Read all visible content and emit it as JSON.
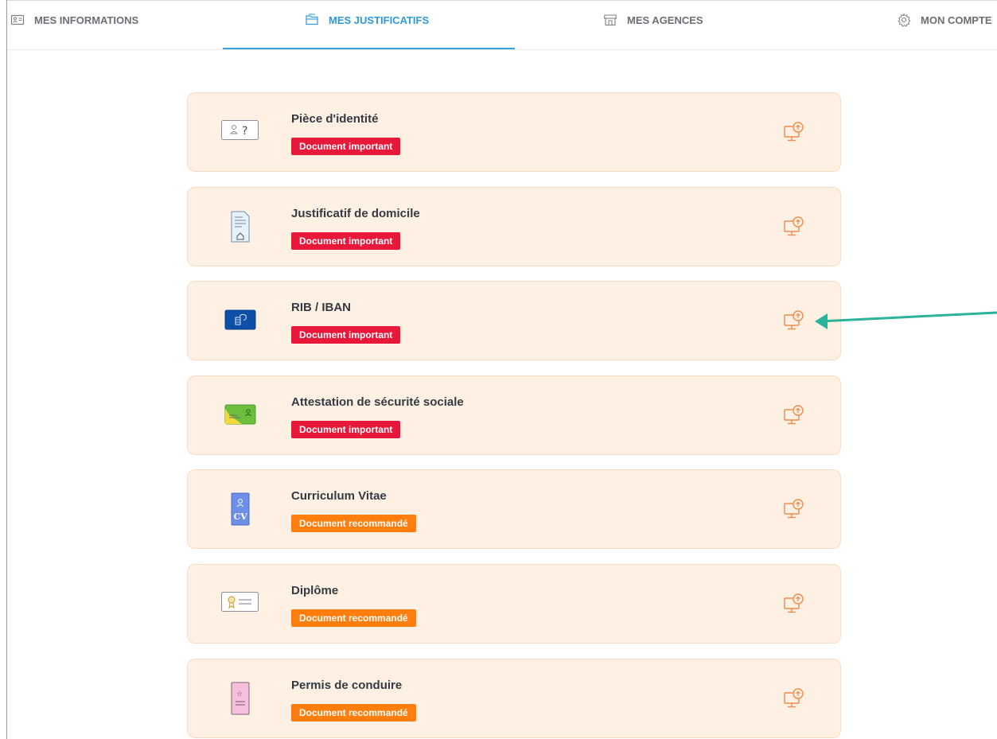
{
  "tabs": [
    {
      "label": "MES INFORMATIONS",
      "icon": "id-card-icon",
      "active": false
    },
    {
      "label": "MES JUSTIFICATIFS",
      "icon": "folder-icon",
      "active": true
    },
    {
      "label": "MES AGENCES",
      "icon": "store-icon",
      "active": false
    },
    {
      "label": "MON COMPTE",
      "icon": "gear-icon",
      "active": false
    }
  ],
  "colors": {
    "accent": "#3aa0dc",
    "badge_important": "#e8183b",
    "badge_recommended": "#ff7e0d",
    "card_bg": "#fff0e4",
    "upload_icon": "#f08a4b",
    "annotation_arrow": "#2bb39a"
  },
  "documents": [
    {
      "title": "Pièce d'identité",
      "badge": "Document important",
      "badge_type": "important",
      "icon": "identity-card-icon"
    },
    {
      "title": "Justificatif de domicile",
      "badge": "Document important",
      "badge_type": "important",
      "icon": "home-document-icon"
    },
    {
      "title": "RIB / IBAN",
      "badge": "Document important",
      "badge_type": "important",
      "icon": "bank-card-icon"
    },
    {
      "title": "Attestation de sécurité sociale",
      "badge": "Document important",
      "badge_type": "important",
      "icon": "health-card-icon"
    },
    {
      "title": "Curriculum Vitae",
      "badge": "Document recommandé",
      "badge_type": "recommended",
      "icon": "cv-icon"
    },
    {
      "title": "Diplôme",
      "badge": "Document recommandé",
      "badge_type": "recommended",
      "icon": "diploma-icon"
    },
    {
      "title": "Permis de conduire",
      "badge": "Document recommandé",
      "badge_type": "recommended",
      "icon": "driving-license-icon"
    }
  ]
}
